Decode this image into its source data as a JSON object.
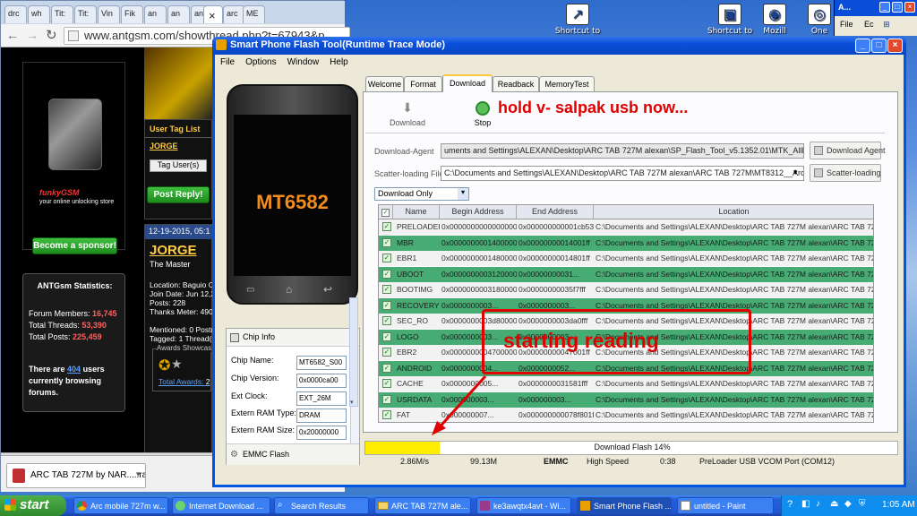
{
  "desktop": {
    "icons": [
      {
        "label": "Shortcut to",
        "icon": "shortcut-icon"
      },
      {
        "label": "Shortcut to",
        "icon": "shortcut-icon"
      },
      {
        "label": "Mozill",
        "icon": "mozilla-icon"
      },
      {
        "label": "One",
        "icon": "onenote-icon"
      }
    ]
  },
  "browser": {
    "tabs": [
      "drc",
      "wh",
      "Tit:",
      "Tit:",
      "Vin",
      "Fik",
      "an",
      "an",
      "an",
      "an",
      "arc",
      "ME"
    ],
    "close_glyph": "×",
    "url": "www.antgsm.com/showthread.php?t=67943&p",
    "forum": {
      "brand_line": "your online unlocking store",
      "sponsor_button": "Become a sponsor!",
      "stats_title": "ANTGsm Statistics:",
      "stats": [
        {
          "label": "Forum Members:",
          "value": "16,745"
        },
        {
          "label": "Total Threads:",
          "value": "53,390"
        },
        {
          "label": "Total Posts:",
          "value": "225,459"
        }
      ],
      "browsing_pre": "There are ",
      "browsing_count": "404",
      "browsing_post": " users currently browsing forums.",
      "tag_list_title": "User Tag List",
      "tag_user": "JORGE",
      "tag_button": "Tag User(s)",
      "post_reply": "Post Reply!",
      "post_date": "12-19-2015, 05:1",
      "post_user": "JORGE",
      "post_rank": "The Master",
      "post_info": [
        "Location: Baguio Cit",
        "Join Date: Jun 12,20",
        "Posts: 228",
        "Thanks Meter: 490",
        "",
        "Mentioned: 0 Post(s",
        "Tagged: 1 Thread(s"
      ],
      "awards_title": "Awards Showcas",
      "total_awards_label": "Total Awards:",
      "total_awards": "2"
    },
    "download_item": "ARC TAB 727M by NAR.....rar"
  },
  "flash_tool": {
    "title": "Smart Phone Flash Tool(Runtime Trace Mode)",
    "menu": [
      "File",
      "Options",
      "Window",
      "Help"
    ],
    "phone_chip": "MT6582",
    "tabs": [
      "Welcome",
      "Format",
      "Download",
      "Readback",
      "MemoryTest"
    ],
    "active_tab": "Download",
    "toolbar": {
      "download": "Download",
      "stop": "Stop"
    },
    "note_hold": "hold v- salpak usb now...",
    "download_agent_label": "Download-Agent",
    "download_agent_value": "uments and Settings\\ALEXAN\\Desktop\\ARC TAB 727M alexan\\SP_Flash_Tool_v5.1352.01\\MTK_AllInOne_DA.bin",
    "download_agent_button": "Download Agent",
    "scatter_label": "Scatter-loading File",
    "scatter_value": "C:\\Documents and Settings\\ALEXAN\\Desktop\\ARC TAB 727M alexan\\ARC TAB 727M\\MT8312__Arc__Tab 727M",
    "scatter_button": "Scatter-loading",
    "mode": "Download Only",
    "columns": [
      "Name",
      "Begin Address",
      "End Address",
      "Location"
    ],
    "rows": [
      {
        "name": "PRELOADER",
        "begin": "0x0000000000000000",
        "end": "0x000000000001cb53",
        "loc": "C:\\Documents and Settings\\ALEXAN\\Desktop\\ARC TAB 727M alexan\\ARC TAB 727M"
      },
      {
        "name": "MBR",
        "begin": "0x0000000001400000",
        "end": "0x00000000014001ff",
        "loc": "C:\\Documents and Settings\\ALEXAN\\Desktop\\ARC TAB 727M alexan\\ARC TAB 727M"
      },
      {
        "name": "EBR1",
        "begin": "0x0000000001480000",
        "end": "0x00000000014801ff",
        "loc": "C:\\Documents and Settings\\ALEXAN\\Desktop\\ARC TAB 727M alexan\\ARC TAB 727M"
      },
      {
        "name": "UBOOT",
        "begin": "0x0000000003120000",
        "end": "0x00000000031...",
        "loc": "C:\\Documents and Settings\\ALEXAN\\Desktop\\ARC TAB 727M alexan\\ARC TAB 727M"
      },
      {
        "name": "BOOTIMG",
        "begin": "0x0000000003180000",
        "end": "0x00000000035f7fff",
        "loc": "C:\\Documents and Settings\\ALEXAN\\Desktop\\ARC TAB 727M alexan\\ARC TAB 727M"
      },
      {
        "name": "RECOVERY",
        "begin": "0x0000000003...",
        "end": "0x0000000003...",
        "loc": "C:\\Documents and Settings\\ALEXAN\\Desktop\\ARC TAB 727M alexan\\ARC TAB 727M"
      },
      {
        "name": "SEC_RO",
        "begin": "0x0000000003d80000",
        "end": "0x0000000003da0fff",
        "loc": "C:\\Documents and Settings\\ALEXAN\\Desktop\\ARC TAB 727M alexan\\ARC TAB 727M"
      },
      {
        "name": "LOGO",
        "begin": "0x0000000003...",
        "end": "0x0000000003...",
        "loc": "C:\\Documents and Settings\\ALEXAN\\Desktop\\ARC TAB 727M alexan\\ARC TAB 727M"
      },
      {
        "name": "EBR2",
        "begin": "0x0000000004700000",
        "end": "0x00000000047001ff",
        "loc": "C:\\Documents and Settings\\ALEXAN\\Desktop\\ARC TAB 727M alexan\\ARC TAB 727M"
      },
      {
        "name": "ANDROID",
        "begin": "0x0000000004...",
        "end": "0x0000000052...",
        "loc": "C:\\Documents and Settings\\ALEXAN\\Desktop\\ARC TAB 727M alexan\\ARC TAB 727M"
      },
      {
        "name": "CACHE",
        "begin": "0x0000000005...",
        "end": "0x0000000031581fff",
        "loc": "C:\\Documents and Settings\\ALEXAN\\Desktop\\ARC TAB 727M alexan\\ARC TAB 727M"
      },
      {
        "name": "USRDATA",
        "begin": "0x000000003...",
        "end": "0x000000003...",
        "loc": "C:\\Documents and Settings\\ALEXAN\\Desktop\\ARC TAB 727M alexan\\ARC TAB 727M"
      },
      {
        "name": "FAT",
        "begin": "0x000000007...",
        "end": "0x000000000078f801ff",
        "loc": "C:\\Documents and Settings\\ALEXAN\\Desktop\\ARC TAB 727M alexan\\ARC TAB 727M"
      }
    ],
    "note_reading": "starting reading",
    "chip_info": {
      "header": "Chip Info",
      "fields": [
        {
          "label": "Chip Name:",
          "value": "MT6582_S00"
        },
        {
          "label": "Chip Version:",
          "value": "0x0000ca00"
        },
        {
          "label": "Ext Clock:",
          "value": "EXT_26M"
        },
        {
          "label": "Extern RAM Type:",
          "value": "DRAM"
        },
        {
          "label": "Extern RAM Size:",
          "value": "0x20000000"
        }
      ],
      "emmc_flash": "EMMC Flash"
    },
    "progress_text": "Download Flash 14%",
    "progress_fraction": 0.14,
    "status": {
      "speed": "2.86M/s",
      "size": "99.13M",
      "storage": "EMMC",
      "mode": "High Speed",
      "time": "0:38",
      "port": "PreLoader USB VCOM Port (COM12)"
    }
  },
  "mini_window": {
    "title": "A...",
    "menu": [
      "File",
      "Ec"
    ]
  },
  "taskbar": {
    "start": "start",
    "tasks": [
      "Arc mobile 727m w...",
      "Internet Download ...",
      "Search Results",
      "ARC TAB 727M ale...",
      "ke3awqtx4avt - Wi...",
      "Smart Phone Flash ...",
      "untitled - Paint"
    ],
    "active_task": "Smart Phone Flash ...",
    "clock": "1:05 AM"
  },
  "colors": {
    "green_row": "#47ac73",
    "annotation_red": "#e00000",
    "progress_yellow": "#ffed00",
    "chip_orange": "#f08d1c"
  }
}
